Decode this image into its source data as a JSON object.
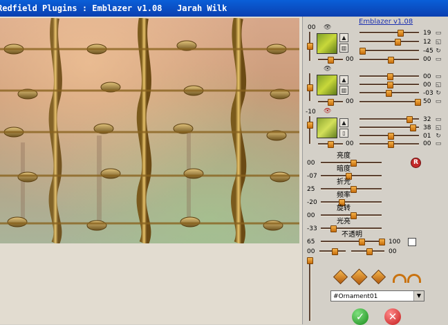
{
  "window": {
    "title": "Redfield Plugins : Emblazer v1.08   Jarah Wilk"
  },
  "panel": {
    "version_link": "Emblazer v1.08",
    "layer1": {
      "left_value": "00",
      "rows": [
        "19",
        "12",
        "-45",
        "00"
      ],
      "bottom_value": "00"
    },
    "layer2": {
      "left_value": "",
      "rows": [
        "00",
        "00",
        "-03",
        "50"
      ],
      "bottom_value": "00"
    },
    "layer3": {
      "left_value": "-10",
      "rows": [
        "32",
        "38",
        "01",
        "00"
      ],
      "bottom_value": "00"
    },
    "adjust": {
      "rows": [
        {
          "label": "亮度",
          "value": "00"
        },
        {
          "label": "暗度",
          "value": "-07"
        },
        {
          "label": "折光",
          "value": "25"
        },
        {
          "label": "频率",
          "value": "-20"
        },
        {
          "label": "旋转",
          "value": "00"
        },
        {
          "label": "光亮",
          "value": "-33"
        },
        {
          "label": "不透明",
          "value": "65"
        }
      ],
      "opacity_max": "100",
      "extra_left": "00",
      "extra_right": "00",
      "reset_badge": "R"
    },
    "dropdown": {
      "selected": "#Ornament01"
    },
    "ok_label": "✓",
    "cancel_label": "✕"
  },
  "colors": {
    "titlebar": "#0b4fc4",
    "accent": "#e08a1e",
    "panel_bg": "#d4d0c8"
  },
  "icons": [
    "eye-icon",
    "arrow-up-icon",
    "grid-icon",
    "copy-icon",
    "rotate-icon",
    "diamond-icon",
    "arc-icon",
    "ok-icon",
    "cancel-icon"
  ]
}
